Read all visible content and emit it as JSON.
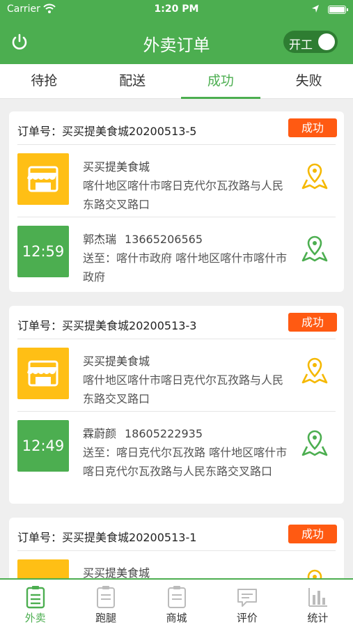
{
  "status": {
    "carrier": "Carrier",
    "time": "1:20 PM"
  },
  "header": {
    "title": "外卖订单",
    "toggle_label": "开工"
  },
  "tabs": [
    {
      "label": "待抢"
    },
    {
      "label": "配送"
    },
    {
      "label": "成功"
    },
    {
      "label": "失败"
    }
  ],
  "orders": [
    {
      "order_label": "订单号：",
      "order_no": "买买提美食城20200513-5",
      "status": "成功",
      "shop_name": "买买提美食城",
      "shop_address": "喀什地区喀什市喀日克代尔瓦孜路与人民东路交叉路口",
      "timer": "12:59",
      "customer_name": "郭杰瑞",
      "customer_phone": "13665206565",
      "deliver_to": "送至：喀什市政府 喀什地区喀什市喀什市政府"
    },
    {
      "order_label": "订单号：",
      "order_no": "买买提美食城20200513-3",
      "status": "成功",
      "shop_name": "买买提美食城",
      "shop_address": "喀什地区喀什市喀日克代尔瓦孜路与人民东路交叉路口",
      "timer": "12:49",
      "customer_name": "霖蔚颜",
      "customer_phone": "18605222935",
      "deliver_to": "送至：喀日克代尔瓦孜路 喀什地区喀什市喀日克代尔瓦孜路与人民东路交叉路口"
    },
    {
      "order_label": "订单号：",
      "order_no": "买买提美食城20200513-1",
      "status": "成功",
      "shop_name": "买买提美食城"
    }
  ],
  "tabbar": [
    {
      "label": "外卖",
      "active": true
    },
    {
      "label": "跑腿"
    },
    {
      "label": "商城"
    },
    {
      "label": "评价"
    },
    {
      "label": "统计"
    }
  ],
  "colors": {
    "brand_green": "#4cae50",
    "badge_orange": "#ff5a12",
    "shop_yellow": "#ffbf15"
  }
}
